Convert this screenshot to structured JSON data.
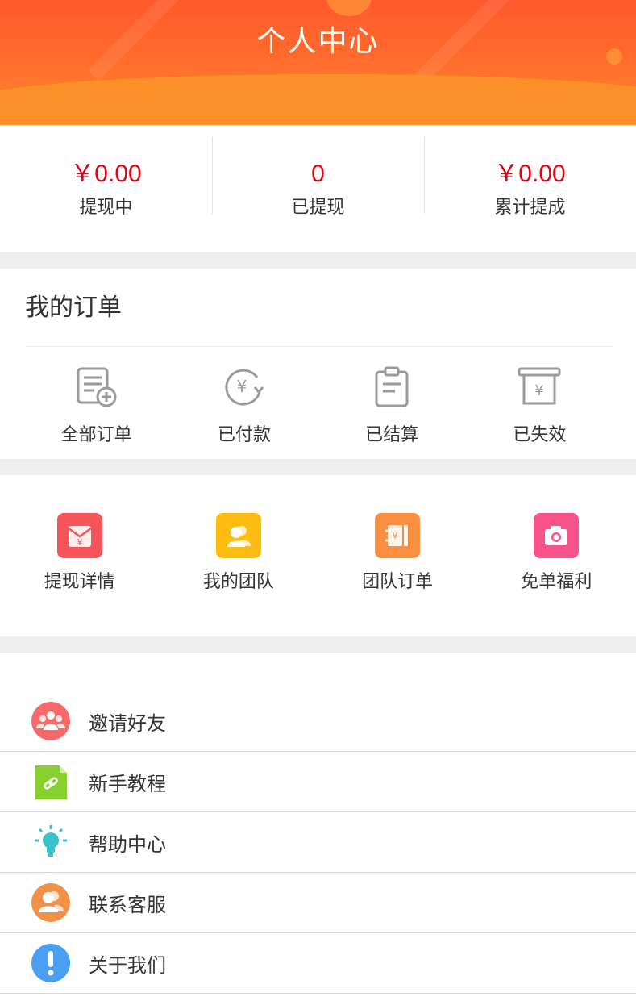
{
  "header": {
    "title": "个人中心"
  },
  "stats": [
    {
      "value": "￥0.00",
      "label": "提现中"
    },
    {
      "value": "0",
      "label": "已提现"
    },
    {
      "value": "￥0.00",
      "label": "累计提成"
    }
  ],
  "orders": {
    "title": "我的订单",
    "items": [
      {
        "label": "全部订单",
        "icon": "all-orders-icon"
      },
      {
        "label": "已付款",
        "icon": "paid-icon"
      },
      {
        "label": "已结算",
        "icon": "settled-icon"
      },
      {
        "label": "已失效",
        "icon": "expired-icon"
      }
    ]
  },
  "features": [
    {
      "label": "提现详情",
      "icon": "red-envelope-icon",
      "color": "#f4545a"
    },
    {
      "label": "我的团队",
      "icon": "team-icon",
      "color": "#fdbd10"
    },
    {
      "label": "团队订单",
      "icon": "team-order-icon",
      "color": "#fa8f42"
    },
    {
      "label": "免单福利",
      "icon": "camera-icon",
      "color": "#f7538a"
    }
  ],
  "menu": [
    {
      "label": "邀请好友",
      "icon": "invite-friends-icon",
      "color": "#f76a6a"
    },
    {
      "label": "新手教程",
      "icon": "tutorial-icon",
      "color": "#86d12f"
    },
    {
      "label": "帮助中心",
      "icon": "lightbulb-icon",
      "color": "#39c2c9"
    },
    {
      "label": "联系客服",
      "icon": "customer-service-icon",
      "color": "#f0914a"
    },
    {
      "label": "关于我们",
      "icon": "info-icon",
      "color": "#4a9ff0"
    }
  ],
  "colors": {
    "accent": "#e60012",
    "header_start": "#ff5a2c",
    "header_end": "#fb8a2c",
    "gap": "#eeeeee"
  }
}
